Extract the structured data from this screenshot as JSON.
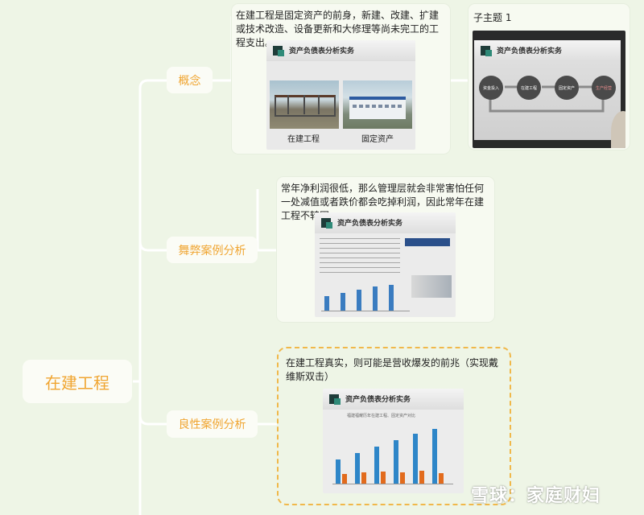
{
  "root": {
    "label": "在建工程"
  },
  "branches": [
    {
      "label": "概念"
    },
    {
      "label": "舞弊案例分析"
    },
    {
      "label": "良性案例分析"
    }
  ],
  "concept": {
    "text": "在建工程是固定资产的前身，新建、改建、扩建或技术改造、设备更新和大修理等尚未完工的工程支出。",
    "slide_title": "资产负债表分析实务",
    "caption_left": "在建工程",
    "caption_right": "固定资产"
  },
  "subtopic": {
    "label": "子主题 1",
    "slide_title": "资产负债表分析实务",
    "flow_steps": [
      "资金投入",
      "在建工程",
      "固定资产",
      "生产经营"
    ]
  },
  "fraud": {
    "text": "常年净利润很低，那么管理层就会非常害怕任何一处减值或者跌价都会吃掉利润，因此常年在建工程不转固",
    "slide_title": "资产负债表分析实务"
  },
  "benign": {
    "text": "在建工程真实，则可能是营收爆发的前兆（实现戴维斯双击）",
    "slide_title": "资产负债表分析实务",
    "chart_subtitle": "福建福耀历年在建工程、固定资产对比"
  },
  "watermark": {
    "text": "雪球：家庭财妇"
  },
  "colors": {
    "accent": "#f0a531",
    "connector": "#ffffff",
    "bg": "#eef5e6",
    "dash": "#f0b84a",
    "bar_blue": "#2e86c8",
    "bar_orange": "#e26b1d"
  }
}
